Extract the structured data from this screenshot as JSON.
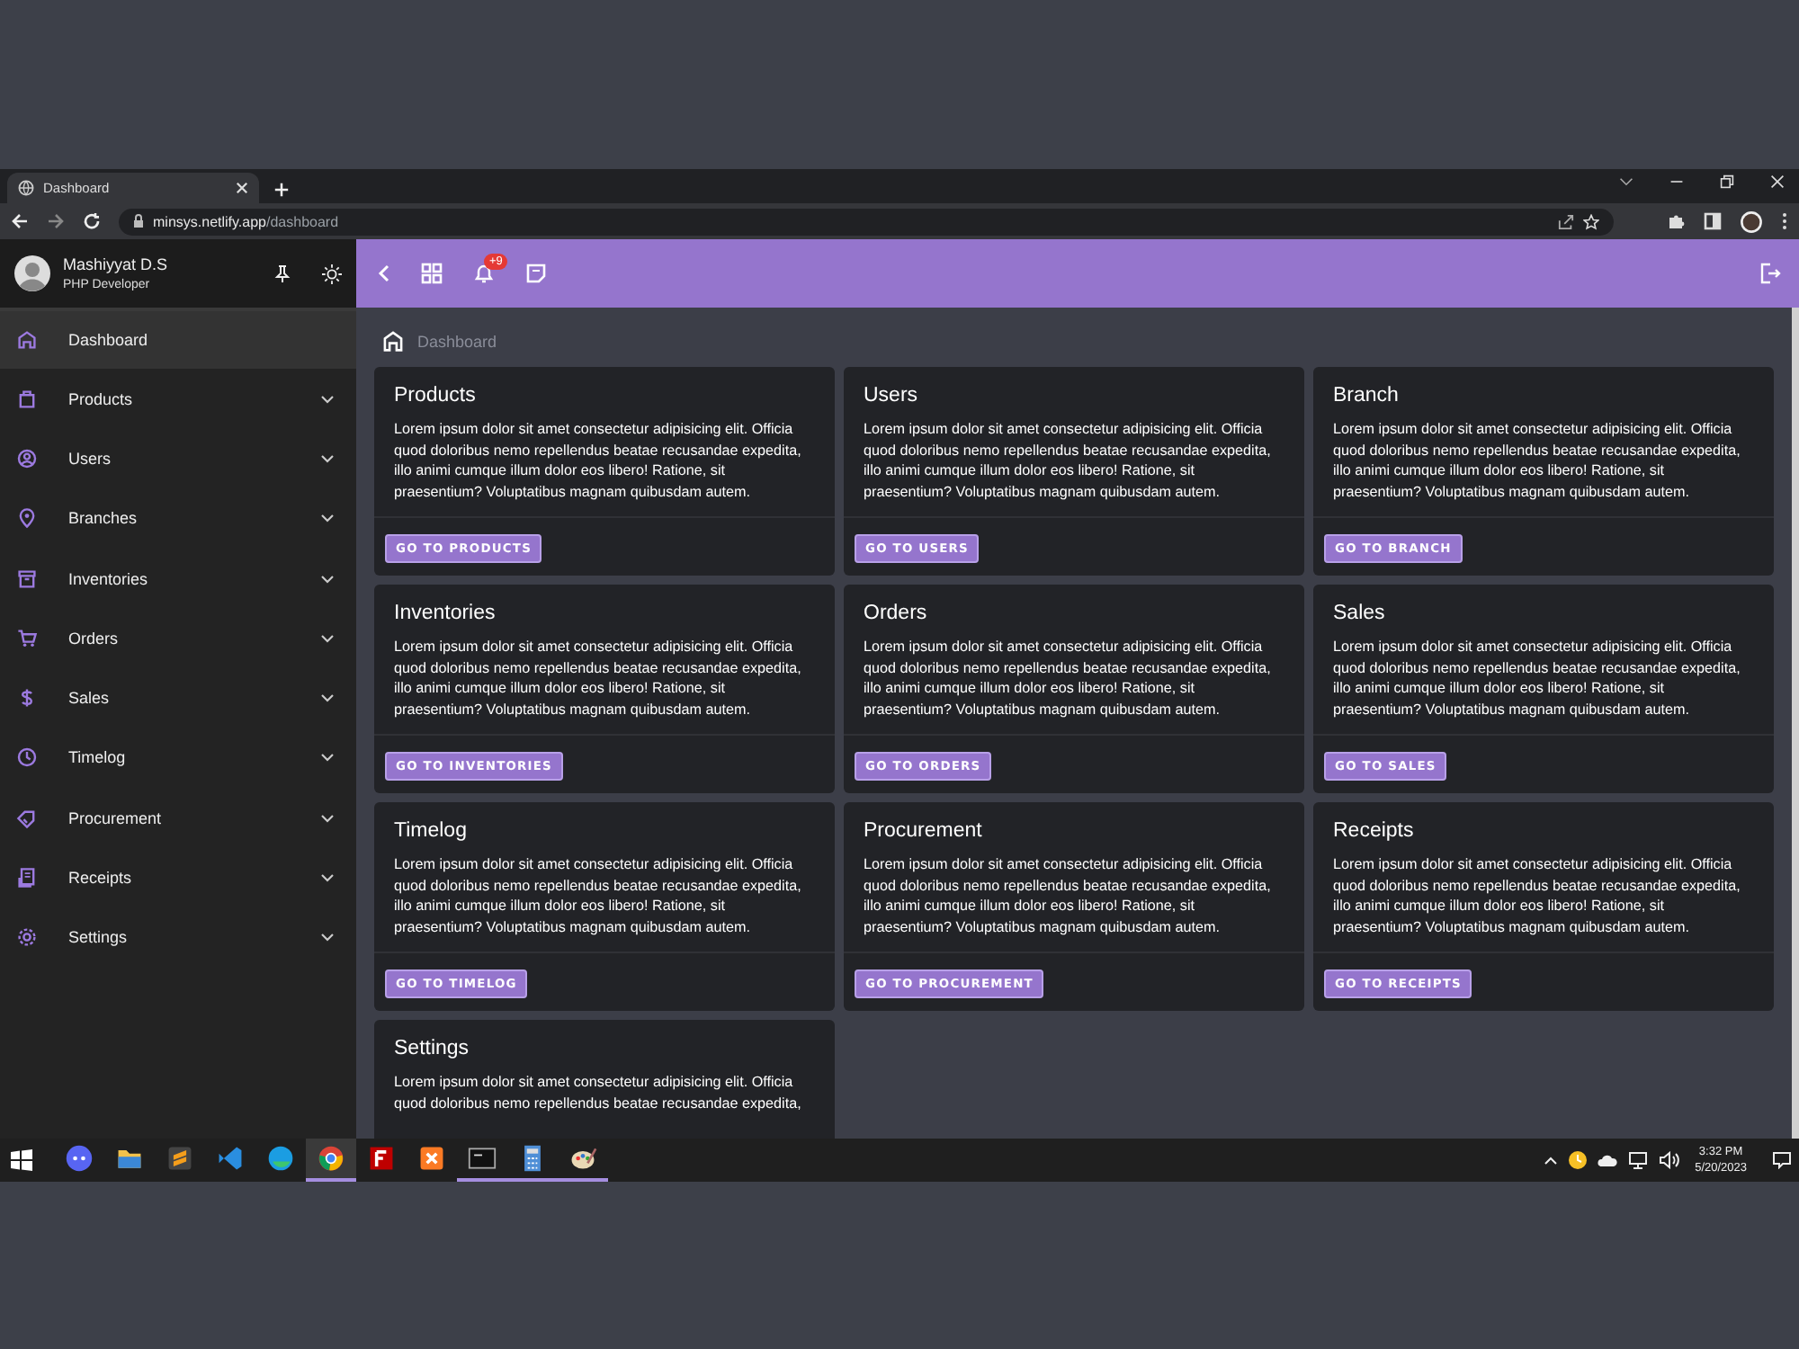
{
  "browser": {
    "tab_title": "Dashboard",
    "url_host": "minsys.netlify.app",
    "url_path": "/dashboard"
  },
  "user": {
    "name": "Mashiyyat D.S",
    "role": "PHP Developer"
  },
  "sidebar": {
    "items": [
      {
        "label": "Dashboard",
        "selected": true,
        "expandable": false
      },
      {
        "label": "Products",
        "selected": false,
        "expandable": true
      },
      {
        "label": "Users",
        "selected": false,
        "expandable": true
      },
      {
        "label": "Branches",
        "selected": false,
        "expandable": true
      },
      {
        "label": "Inventories",
        "selected": false,
        "expandable": true
      },
      {
        "label": "Orders",
        "selected": false,
        "expandable": true
      },
      {
        "label": "Sales",
        "selected": false,
        "expandable": true
      },
      {
        "label": "Timelog",
        "selected": false,
        "expandable": true
      },
      {
        "label": "Procurement",
        "selected": false,
        "expandable": true
      },
      {
        "label": "Receipts",
        "selected": false,
        "expandable": true
      },
      {
        "label": "Settings",
        "selected": false,
        "expandable": true
      }
    ]
  },
  "topbar": {
    "notification_badge": "+9"
  },
  "breadcrumb": "Dashboard",
  "cards": [
    {
      "title": "Products",
      "text": "Lorem ipsum dolor sit amet consectetur adipisicing elit. Officia quod doloribus nemo repellendus beatae recusandae expedita, illo animi cumque illum dolor eos libero! Ratione, sit praesentium? Voluptatibus magnam quibusdam autem.",
      "button": "GO TO PRODUCTS"
    },
    {
      "title": "Users",
      "text": "Lorem ipsum dolor sit amet consectetur adipisicing elit. Officia quod doloribus nemo repellendus beatae recusandae expedita, illo animi cumque illum dolor eos libero! Ratione, sit praesentium? Voluptatibus magnam quibusdam autem.",
      "button": "GO TO USERS"
    },
    {
      "title": "Branch",
      "text": "Lorem ipsum dolor sit amet consectetur adipisicing elit. Officia quod doloribus nemo repellendus beatae recusandae expedita, illo animi cumque illum dolor eos libero! Ratione, sit praesentium? Voluptatibus magnam quibusdam autem.",
      "button": "GO TO BRANCH"
    },
    {
      "title": "Inventories",
      "text": "Lorem ipsum dolor sit amet consectetur adipisicing elit. Officia quod doloribus nemo repellendus beatae recusandae expedita, illo animi cumque illum dolor eos libero! Ratione, sit praesentium? Voluptatibus magnam quibusdam autem.",
      "button": "GO TO INVENTORIES"
    },
    {
      "title": "Orders",
      "text": "Lorem ipsum dolor sit amet consectetur adipisicing elit. Officia quod doloribus nemo repellendus beatae recusandae expedita, illo animi cumque illum dolor eos libero! Ratione, sit praesentium? Voluptatibus magnam quibusdam autem.",
      "button": "GO TO ORDERS"
    },
    {
      "title": "Sales",
      "text": "Lorem ipsum dolor sit amet consectetur adipisicing elit. Officia quod doloribus nemo repellendus beatae recusandae expedita, illo animi cumque illum dolor eos libero! Ratione, sit praesentium? Voluptatibus magnam quibusdam autem.",
      "button": "GO TO SALES"
    },
    {
      "title": "Timelog",
      "text": "Lorem ipsum dolor sit amet consectetur adipisicing elit. Officia quod doloribus nemo repellendus beatae recusandae expedita, illo animi cumque illum dolor eos libero! Ratione, sit praesentium? Voluptatibus magnam quibusdam autem.",
      "button": "GO TO TIMELOG"
    },
    {
      "title": "Procurement",
      "text": "Lorem ipsum dolor sit amet consectetur adipisicing elit. Officia quod doloribus nemo repellendus beatae recusandae expedita, illo animi cumque illum dolor eos libero! Ratione, sit praesentium? Voluptatibus magnam quibusdam autem.",
      "button": "GO TO PROCUREMENT"
    },
    {
      "title": "Receipts",
      "text": "Lorem ipsum dolor sit amet consectetur adipisicing elit. Officia quod doloribus nemo repellendus beatae recusandae expedita, illo animi cumque illum dolor eos libero! Ratione, sit praesentium? Voluptatibus magnam quibusdam autem.",
      "button": "GO TO RECEIPTS"
    },
    {
      "title": "Settings",
      "text": "Lorem ipsum dolor sit amet consectetur adipisicing elit. Officia quod doloribus nemo repellendus beatae recusandae expedita,"
    }
  ],
  "taskbar": {
    "apps": [
      {
        "kind": "discord",
        "running": false,
        "selected": false
      },
      {
        "kind": "folder",
        "running": false,
        "selected": false
      },
      {
        "kind": "sublime",
        "running": false,
        "selected": false
      },
      {
        "kind": "vscode",
        "running": false,
        "selected": false
      },
      {
        "kind": "edge",
        "running": false,
        "selected": false
      },
      {
        "kind": "chrome",
        "running": true,
        "selected": true
      },
      {
        "kind": "filezilla",
        "running": false,
        "selected": false
      },
      {
        "kind": "xampp",
        "running": false,
        "selected": false
      },
      {
        "kind": "terminal",
        "running": true,
        "selected": false
      },
      {
        "kind": "calculator",
        "running": true,
        "selected": false
      },
      {
        "kind": "paint",
        "running": true,
        "selected": false
      }
    ],
    "time": "3:32 PM",
    "date": "5/20/2023"
  }
}
